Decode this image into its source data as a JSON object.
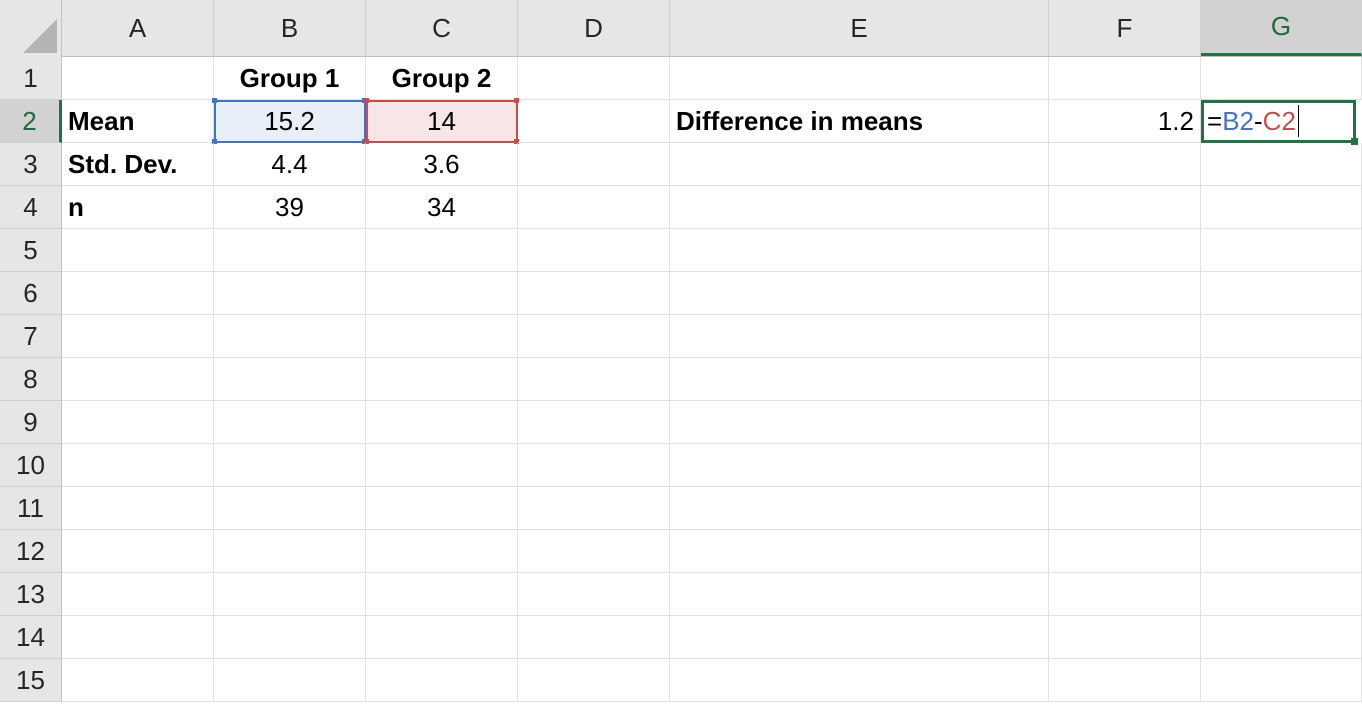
{
  "columns": [
    "A",
    "B",
    "C",
    "D",
    "E",
    "F",
    "G"
  ],
  "rows": [
    "1",
    "2",
    "3",
    "4",
    "5",
    "6",
    "7",
    "8",
    "9",
    "10",
    "11",
    "12",
    "13",
    "14",
    "15"
  ],
  "cells": {
    "B1": "Group 1",
    "C1": "Group 2",
    "A2": "Mean",
    "B2": "15.2",
    "C2": "14",
    "E2": "Difference in means",
    "F2": "1.2",
    "A3": "Std. Dev.",
    "B3": "4.4",
    "C3": "3.6",
    "A4": "n",
    "B4": "39",
    "C4": "34"
  },
  "formula": {
    "cell": "G2",
    "equals": "=",
    "ref1": "B2",
    "operator": "-",
    "ref2": "C2"
  },
  "colors": {
    "ref1": "#4472c4",
    "ref2": "#c0504d",
    "active": "#217346"
  }
}
